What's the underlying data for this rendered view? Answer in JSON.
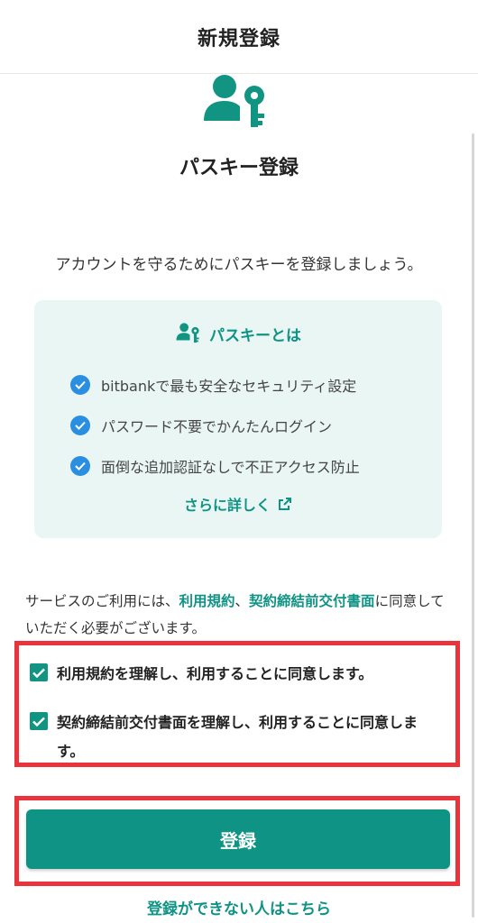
{
  "header": {
    "title": "新規登録"
  },
  "hero": {
    "icon": "user-key-icon",
    "title": "パスキー登録"
  },
  "intro": "アカウントを守るためにパスキーを登録しましょう。",
  "info": {
    "heading_icon": "user-key-icon",
    "heading": "パスキーとは",
    "features": [
      "bitbankで最も安全なセキュリティ設定",
      "パスワード不要でかんたんログイン",
      "面倒な追加認証なしで不正アクセス防止"
    ],
    "more_link": "さらに詳しく",
    "more_icon": "external-link-icon"
  },
  "terms": {
    "prefix": "サービスのご利用には、",
    "link1": "利用規約",
    "sep": "、",
    "link2": "契約締結前交付書面",
    "suffix": "に同意していただく必要がございます。"
  },
  "agreements": [
    {
      "label": "利用規約を理解し、利用することに同意します。",
      "checked": true
    },
    {
      "label": "契約締結前交付書面を理解し、利用することに同意します。",
      "checked": true
    }
  ],
  "register_button": "登録",
  "cannot_register_link": "登録ができない人はこちら",
  "colors": {
    "accent": "#0f9384",
    "check_blue": "#2a8fe0",
    "highlight_red": "#e8343a",
    "info_bg": "#eaf6f4"
  }
}
